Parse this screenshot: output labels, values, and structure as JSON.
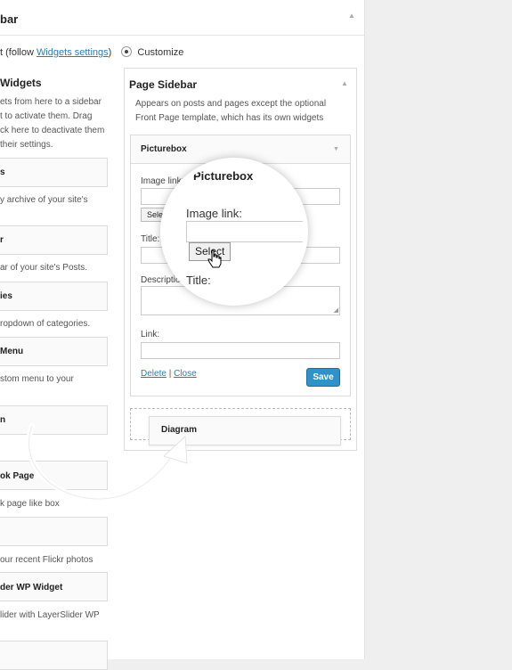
{
  "panel": {
    "title": "bar",
    "mode_prefix": "t (follow ",
    "mode_link": "Widgets settings",
    "mode_suffix": ")",
    "customize_label": "Customize"
  },
  "available": {
    "title": "Widgets",
    "desc_lines": [
      "ets from here to a sidebar",
      "t to activate them. Drag",
      "ck here to deactivate them",
      "their settings."
    ]
  },
  "widgets": [
    {
      "title": "s",
      "desc": "y archive of your site's"
    },
    {
      "title": "r",
      "desc": "ar of your site's Posts."
    },
    {
      "title": "ies",
      "desc": "ropdown of categories."
    },
    {
      "title": "Menu",
      "desc": "stom menu to your"
    },
    {
      "title": "n",
      "desc": ""
    },
    {
      "title": "ok Page",
      "desc": "k page like box"
    },
    {
      "title": "",
      "desc": "our recent Flickr photos"
    },
    {
      "title": "der WP Widget",
      "desc": "lider with LayerSlider WP"
    }
  ],
  "sidebar": {
    "title": "Page Sidebar",
    "desc_lines": [
      "Appears on posts and pages except the optional",
      "Front Page template, which has its own widgets"
    ]
  },
  "picturebox": {
    "title": "Picturebox",
    "image_link_label": "Image link:",
    "select_label": "Select",
    "title_label": "Title:",
    "description_label": "Description:",
    "link_label": "Link:",
    "delete_label": "Delete",
    "separator": "|",
    "close_label": "Close",
    "save_label": "Save"
  },
  "magnifier": {
    "title": "Picturebox",
    "image_link_label": "Image link:",
    "select_label": "Select",
    "title_label": "Title:"
  },
  "dragging": {
    "title": "Diagram"
  },
  "colors": {
    "accent": "#2f92c8",
    "link": "#2a7cb8",
    "background": "#efefef"
  }
}
